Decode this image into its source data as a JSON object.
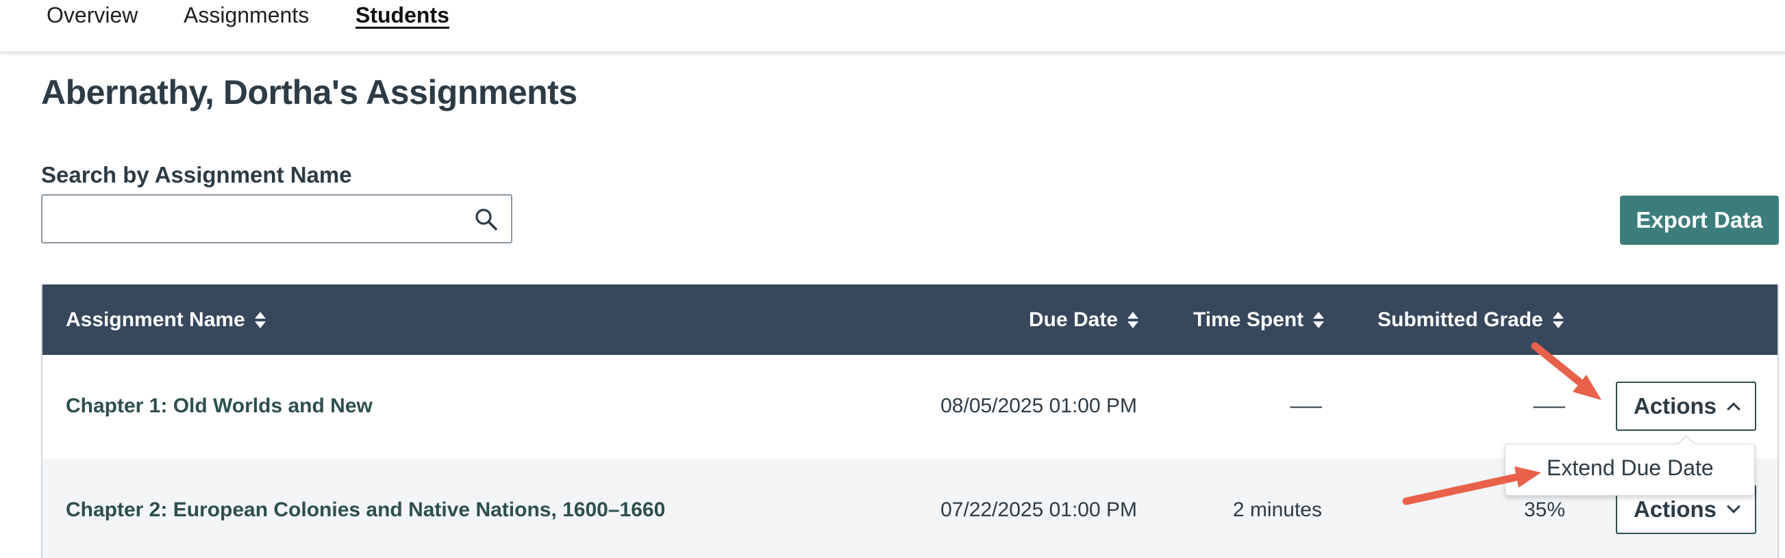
{
  "nav": {
    "tabs": [
      {
        "label": "Overview"
      },
      {
        "label": "Assignments"
      },
      {
        "label": "Students",
        "active": true
      }
    ]
  },
  "page": {
    "title": "Abernathy, Dortha's Assignments"
  },
  "search": {
    "label": "Search by Assignment Name",
    "value": "",
    "placeholder": ""
  },
  "export_button": {
    "label": "Export Data"
  },
  "table": {
    "headers": {
      "name": "Assignment Name",
      "due": "Due Date",
      "time": "Time Spent",
      "grade": "Submitted Grade"
    },
    "rows": [
      {
        "name": "Chapter 1: Old Worlds and New",
        "due": "08/05/2025 01:00 PM",
        "time": "—–",
        "grade": "—–",
        "actions_label": "Actions",
        "actions_state": "open"
      },
      {
        "name": "Chapter 2: European Colonies and Native Nations, 1600–1660",
        "due": "07/22/2025 01:00 PM",
        "time": "2 minutes",
        "grade": "35%",
        "actions_label": "Actions",
        "actions_state": "closed"
      }
    ]
  },
  "actions_menu": {
    "items": [
      {
        "label": "Extend Due Date"
      }
    ]
  },
  "colors": {
    "header_bg": "#37475c",
    "export_bg": "#3c7d7c",
    "link_text": "#2d4f4e",
    "annotation_arrow": "#e8614a"
  }
}
